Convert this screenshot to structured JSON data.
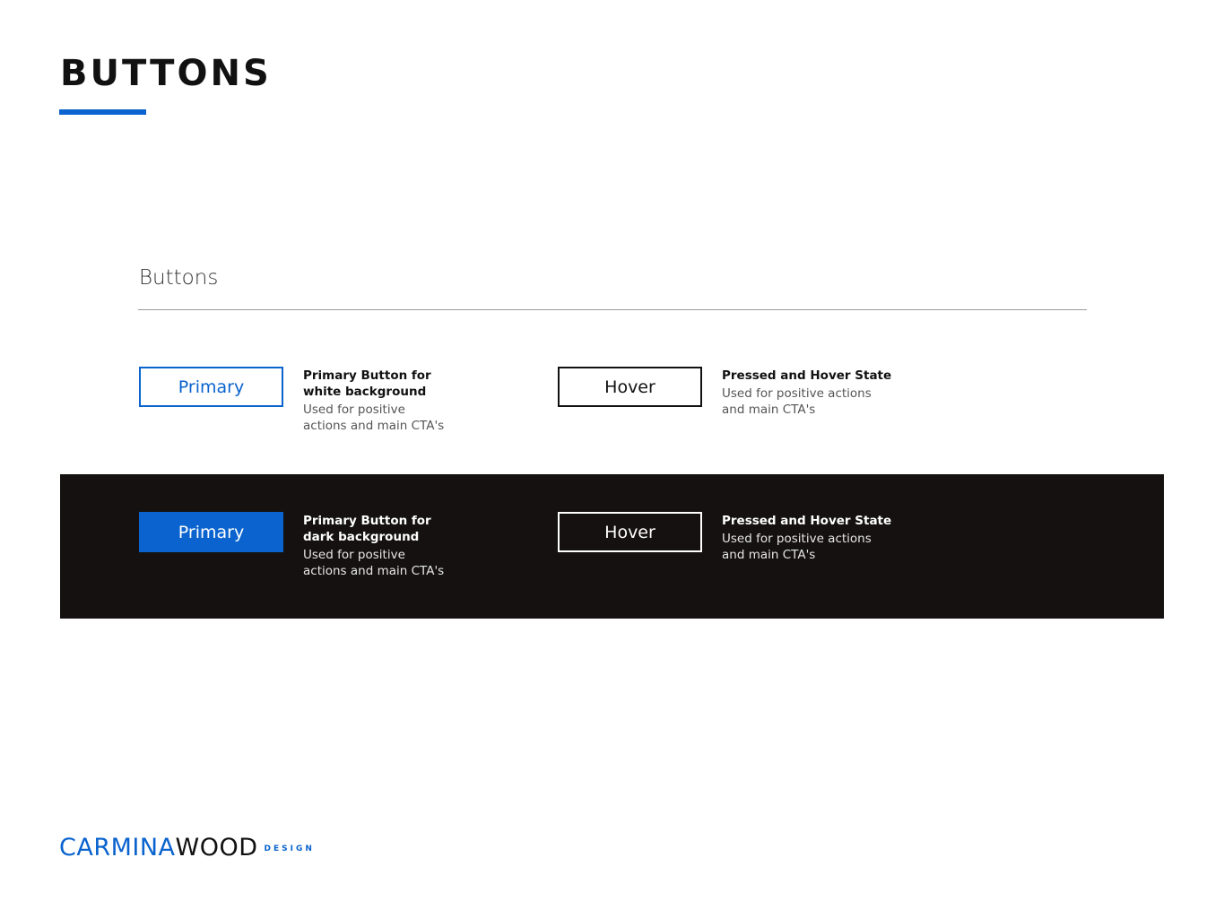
{
  "page": {
    "title": "BUTTONS"
  },
  "section": {
    "heading": "Buttons"
  },
  "light_row": {
    "primary_button_label": "Primary",
    "primary_desc_title_line1": "Primary Button for",
    "primary_desc_title_line2": "white background",
    "primary_desc_body_line1": "Used for positive",
    "primary_desc_body_line2": "actions and main CTA's",
    "hover_button_label": "Hover",
    "hover_desc_title": "Pressed and Hover State",
    "hover_desc_body_line1": "Used for positive actions",
    "hover_desc_body_line2": "and main CTA's"
  },
  "dark_row": {
    "primary_button_label": "Primary",
    "primary_desc_title_line1": "Primary Button for",
    "primary_desc_title_line2": "dark background",
    "primary_desc_body_line1": "Used for positive",
    "primary_desc_body_line2": "actions and main CTA's",
    "hover_button_label": "Hover",
    "hover_desc_title": "Pressed and Hover State",
    "hover_desc_body_line1": "Used for positive actions",
    "hover_desc_body_line2": "and main CTA's"
  },
  "logo": {
    "part1": "CARMINA",
    "part2": "WOOD",
    "part3": "DESIGN"
  },
  "colors": {
    "accent_blue": "#0a63ce",
    "dark_background": "#141110",
    "text_dark": "#111111",
    "divider_gray": "#9a9a9a"
  }
}
